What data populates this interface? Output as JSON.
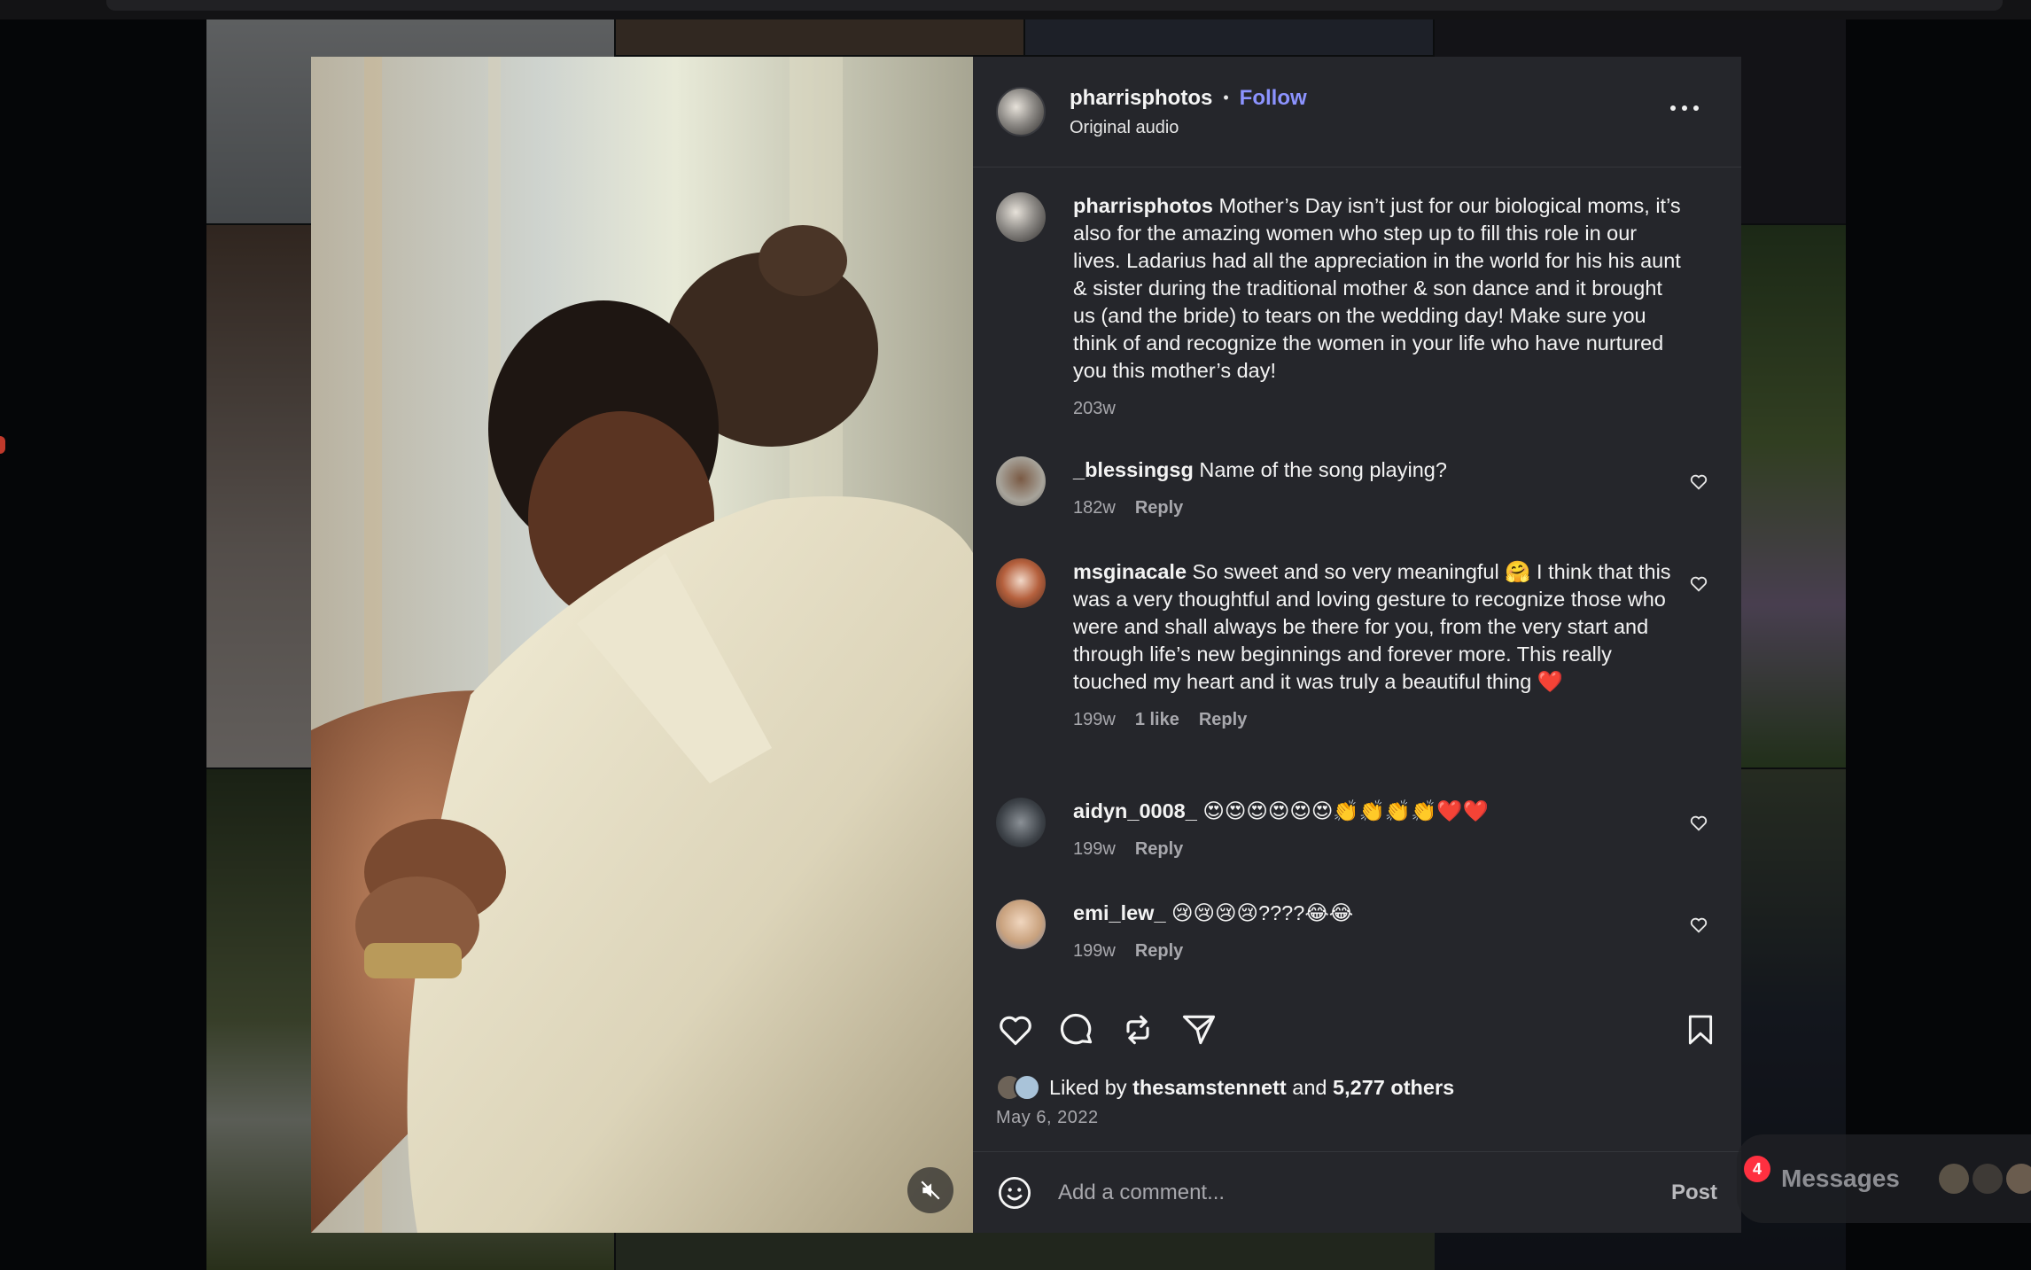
{
  "post": {
    "username": "pharrisphotos",
    "follow_label": "Follow",
    "audio_label": "Original audio",
    "caption_user": "pharrisphotos",
    "caption": "Mother’s Day isn’t just for our biological moms, it’s also for the amazing women who step up to fill this role in our lives. Ladarius had all the appreciation in the world for his his aunt & sister during the traditional mother & son dance and it brought us (and the bride) to tears on the wedding day! Make sure you think of and recognize the women in your life who have nurtured you this mother’s day!",
    "caption_time": "203w"
  },
  "comments": [
    {
      "user": "_blessingsg",
      "text": "Name of the song playing?",
      "time": "182w",
      "likes": "",
      "reply": "Reply"
    },
    {
      "user": "msginacale",
      "text": "So sweet and so very meaningful 🤗 I think that this was a very thoughtful and loving gesture to recognize those who were and shall always be there for you, from the very start and through life’s new beginnings and forever more. This really touched my heart and it was truly a beautiful thing ❤️",
      "time": "199w",
      "likes": "1 like",
      "reply": "Reply"
    },
    {
      "user": "aidyn_0008_",
      "text": "😍😍😍😍😍😍👏👏👏👏❤️❤️",
      "time": "199w",
      "likes": "",
      "reply": "Reply"
    },
    {
      "user": "emi_lew_",
      "text": "😢😢😢😢????😂😂",
      "time": "199w",
      "likes": "",
      "reply": "Reply"
    }
  ],
  "likes": {
    "prefix": "Liked by",
    "user": "thesamstennett",
    "and": "and",
    "others": "5,277 others"
  },
  "date": "May 6, 2022",
  "compose": {
    "placeholder": "Add a comment...",
    "post_label": "Post"
  },
  "messages": {
    "label": "Messages",
    "badge": "4"
  },
  "icons": {
    "like": "heart-icon",
    "comment": "comment-icon",
    "repost": "repost-icon",
    "share": "share-icon",
    "save": "bookmark-icon",
    "more": "more-icon",
    "emoji": "emoji-icon",
    "mute": "muted-icon"
  },
  "colors": {
    "accent": "#8c93ff",
    "panel": "#25262b",
    "muted_text": "#a8a8ad",
    "badge": "#ff3040"
  }
}
